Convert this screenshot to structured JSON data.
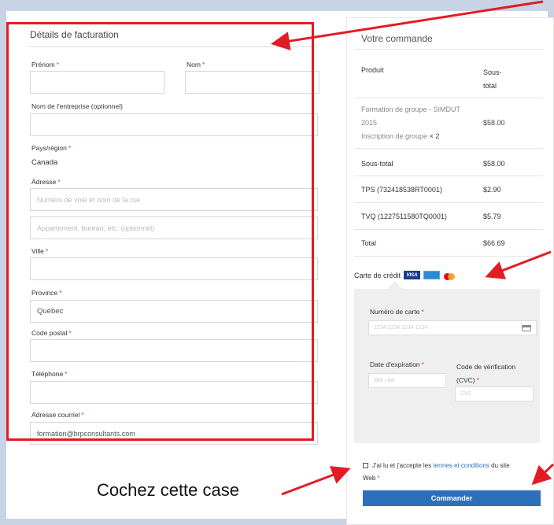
{
  "billing": {
    "title": "Détails de facturation",
    "first_name_label": "Prénom",
    "last_name_label": "Nom",
    "company_label": "Nom de l'entreprise (optionnel)",
    "country_label": "Pays/région",
    "country_value": "Canada",
    "address_label": "Adresse",
    "address1_placeholder": "Numéro de voie et nom de la rue",
    "address2_placeholder": "Appartement, bureau, etc. (optionnel)",
    "city_label": "Ville",
    "province_label": "Province",
    "province_value": "Québec",
    "postal_label": "Code postal",
    "phone_label": "Téléphone",
    "email_label": "Adresse courriel",
    "email_value": "formation@brpconsultants.com",
    "required_mark": "*"
  },
  "order": {
    "title": "Votre commande",
    "col_product": "Produit",
    "col_subtotal_1": "Sous-",
    "col_subtotal_2": "total",
    "item_line1": "Formation de groupe - SIMDUT",
    "item_line2": "2015",
    "item_line3": "Inscription de groupe",
    "item_qty": "× 2",
    "item_price": "$58.00",
    "subtotal_label": "Sous-total",
    "subtotal_value": "$58.00",
    "tps_label": "TPS (732418538RT0001)",
    "tps_value": "$2.90",
    "tvq_label": "TVQ (1227511580TQ0001)",
    "tvq_value": "$5.79",
    "total_label": "Total",
    "total_value": "$66.69"
  },
  "payment": {
    "method_label": "Carte de crédit",
    "visa": "VISA",
    "card_number_label": "Numéro de carte",
    "card_number_placeholder": "1234 1234 1234 1234",
    "expiry_label": "Date d'expiration",
    "expiry_placeholder": "MM / AA",
    "cvc_label_1": "Code de vérification",
    "cvc_label_2": "(CVC)",
    "cvc_placeholder": "CVC"
  },
  "terms": {
    "before": "J'ai lu et j'accepte les",
    "link": "termes et conditions",
    "after": "du site",
    "line2": "Web"
  },
  "submit_label": "Commander",
  "annotation_text": "Cochez cette case",
  "colors": {
    "annotation_red": "#e31b23",
    "button_blue": "#2d6fb8",
    "required_red": "#e2401c"
  }
}
